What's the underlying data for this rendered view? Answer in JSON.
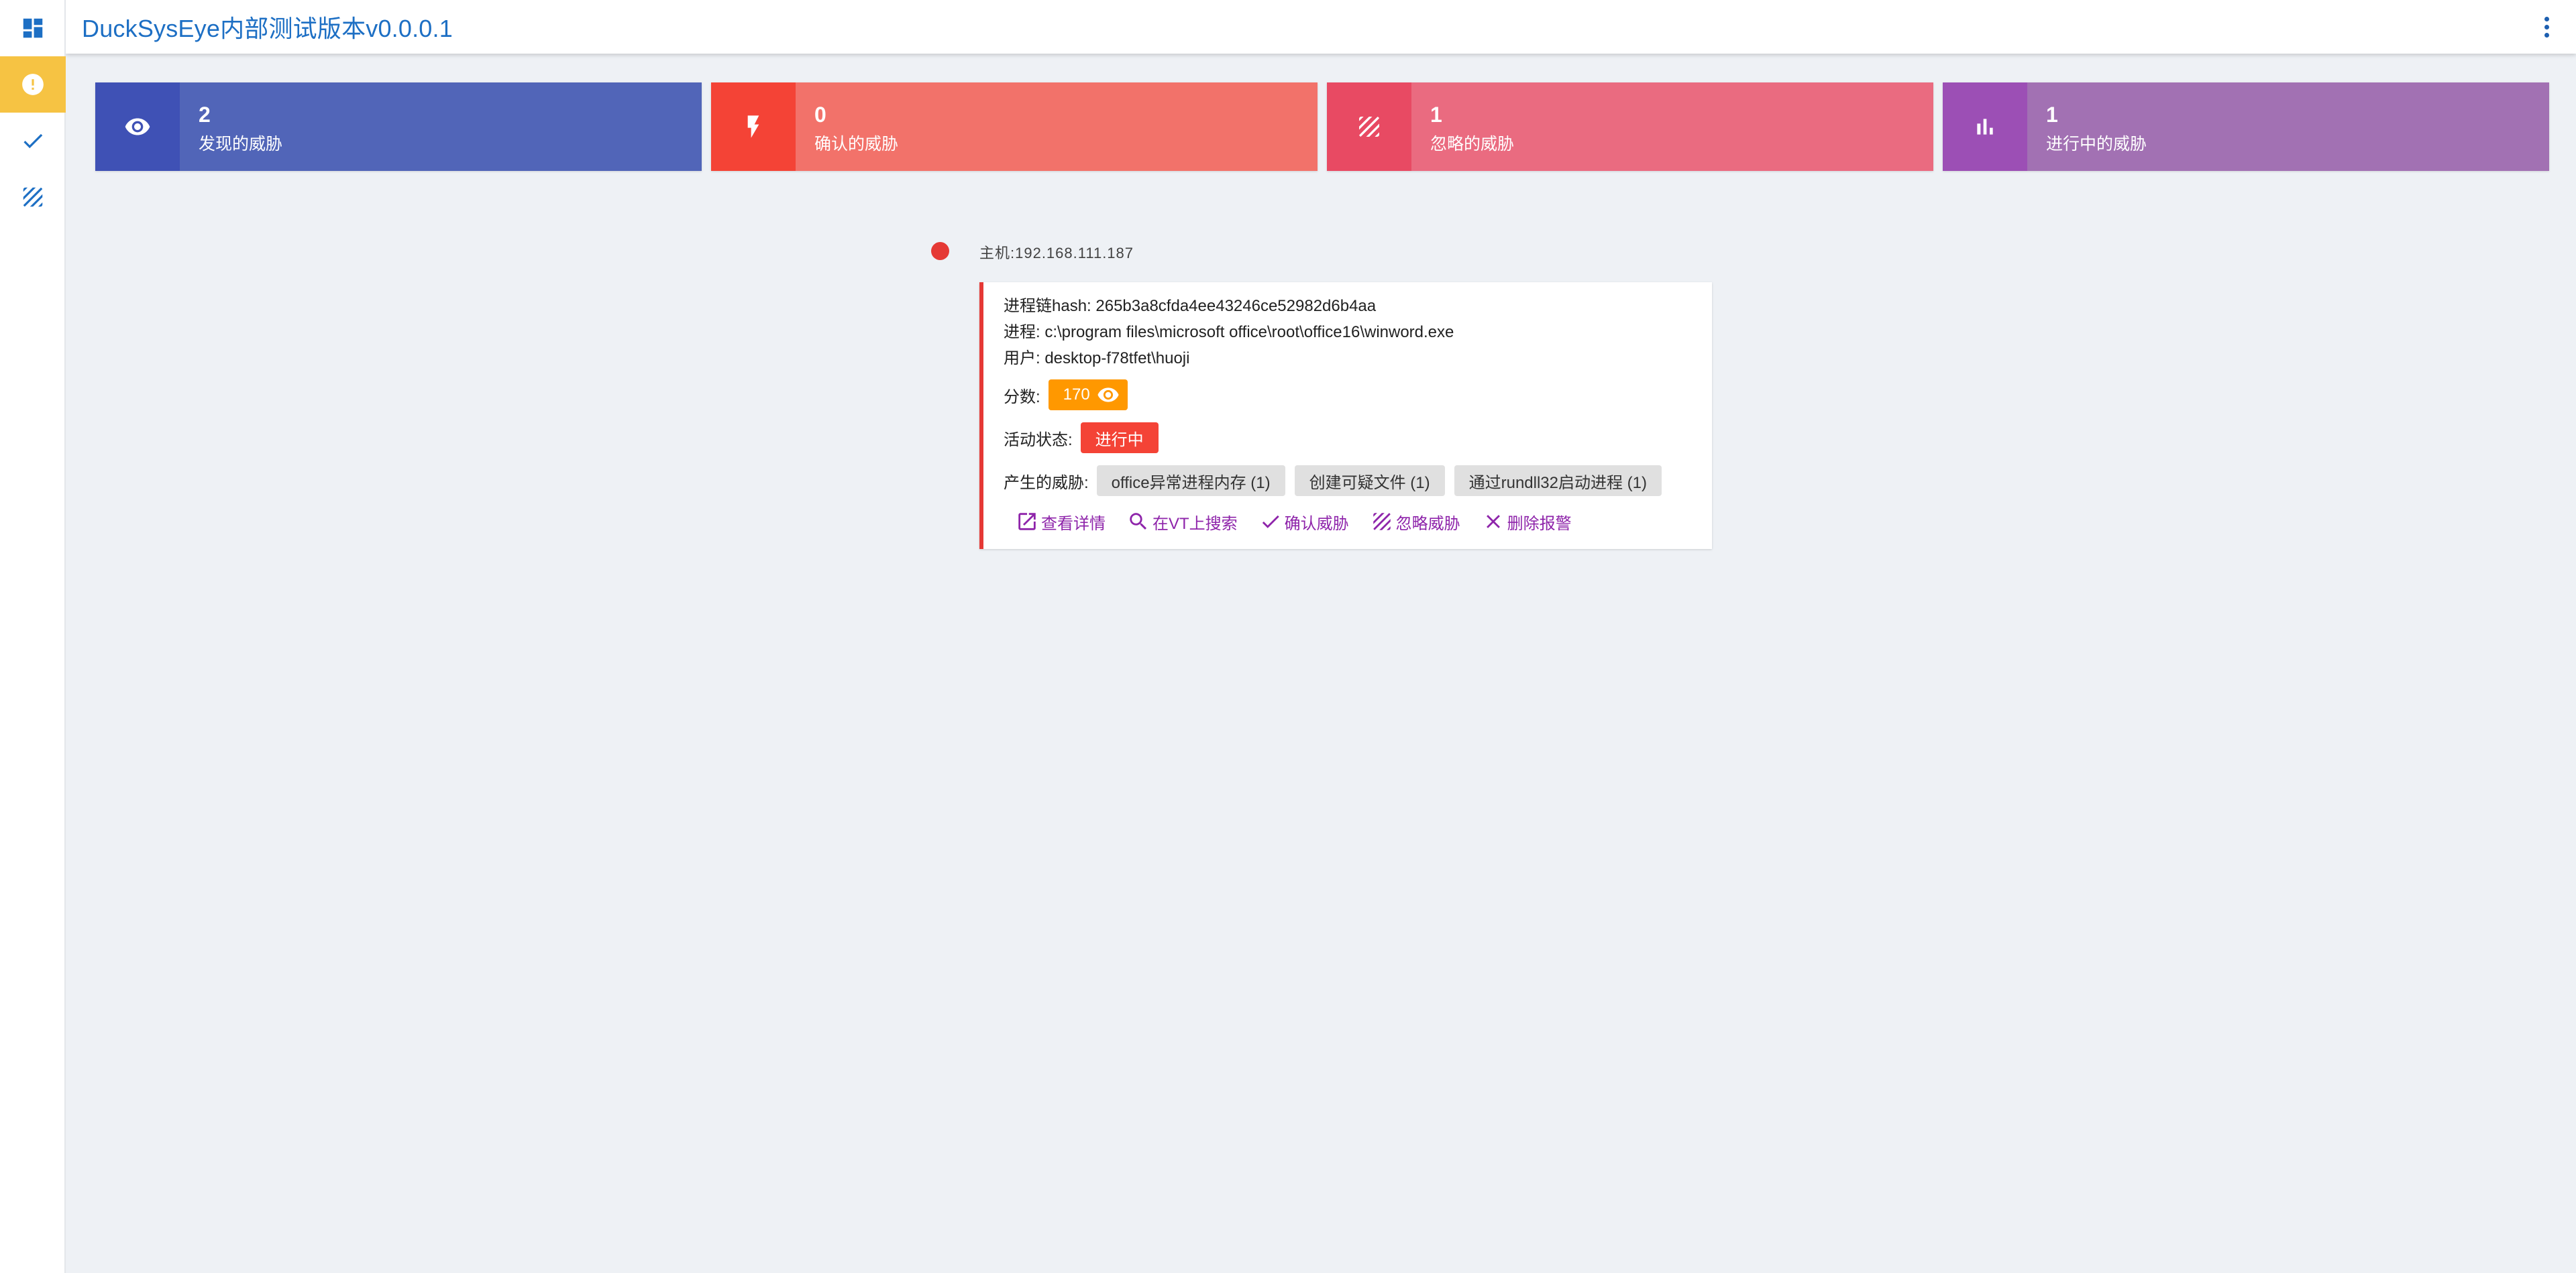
{
  "app": {
    "title": "DuckSysEye内部测试版本v0.0.0.1"
  },
  "sidebar": {
    "items": [
      {
        "icon": "dashboard-icon",
        "active": false
      },
      {
        "icon": "alert-icon",
        "active": true
      },
      {
        "icon": "check-icon",
        "active": false
      },
      {
        "icon": "striped-ignore-icon",
        "active": false
      }
    ]
  },
  "stats": [
    {
      "count": "2",
      "label": "发现的威胁",
      "icon": "eye-icon",
      "color": "#3f51b5"
    },
    {
      "count": "0",
      "label": "确认的威胁",
      "icon": "flash-icon",
      "color": "#f44336"
    },
    {
      "count": "1",
      "label": "忽略的威胁",
      "icon": "striped-ignore-icon",
      "color": "#e84a63"
    },
    {
      "count": "1",
      "label": "进行中的威胁",
      "icon": "bar-chart-icon",
      "color": "#9c4fb5"
    }
  ],
  "host": {
    "label": "主机:192.168.111.187"
  },
  "card": {
    "hash_line": "进程链hash: 265b3a8cfda4ee43246ce52982d6b4aa",
    "process_line": "进程: c:\\program files\\microsoft office\\root\\office16\\winword.exe",
    "user_line": "用户: desktop-f78tfet\\huoji",
    "score_label": "分数:",
    "score_value": "170",
    "state_label": "活动状态:",
    "state_value": "进行中",
    "threats_label": "产生的威胁:",
    "threats": [
      "office异常进程内存 (1)",
      "创建可疑文件 (1)",
      "通过rundll32启动进程 (1)"
    ],
    "actions": [
      "查看详情",
      "在VT上搜索",
      "确认威胁",
      "忽略威胁",
      "删除报警"
    ]
  }
}
